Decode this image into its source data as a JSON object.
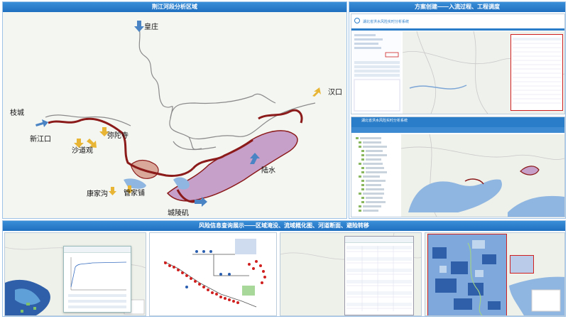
{
  "panels": {
    "main_title": "荆江河段分析区域",
    "right_title": "方案创建——入流过程、工程调度",
    "bottom_title": "风险信息查询展示——区域淹没、流域概化图、河道断面、避险转移"
  },
  "places": {
    "huangzhuang": "皇庄",
    "zhicheng": "枝城",
    "xinjiangkou": "新江口",
    "shadaoguan": "沙道观",
    "mituosi": "弥陀寺",
    "hankou": "汉口",
    "lushui": "陆水",
    "kangjiagou": "康家沟",
    "guanjiapu": "管家铺",
    "chenglingji": "城陵矶"
  },
  "apps": {
    "top_app_title": "湖北省洪水风险实时分析系统",
    "mid_app_title": "湖北省洪水风险实时分析系统"
  },
  "colors": {
    "header_blue": "#1f6fc0",
    "arrow_blue": "#4a84c4",
    "arrow_yellow": "#e8b634",
    "river_red": "#8b1a1a",
    "flood_pink": "#c7a0c9",
    "water_blue": "#8fb6e0"
  }
}
